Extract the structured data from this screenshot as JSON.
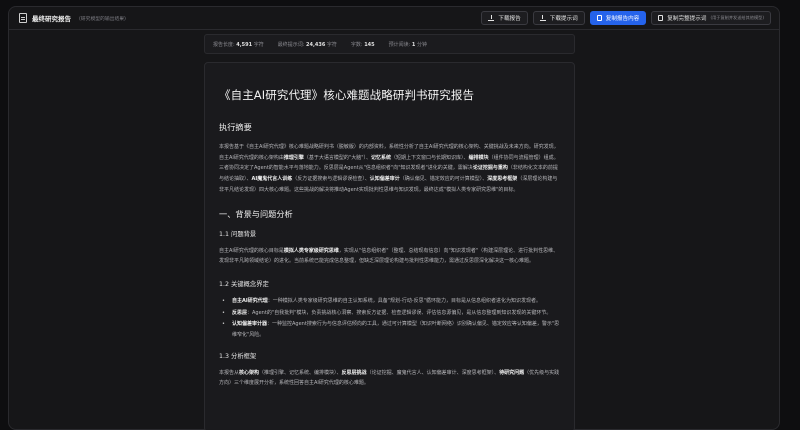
{
  "header": {
    "title": "最终研究报告",
    "subtitle": "(研究模型的输出结果)",
    "buttons": {
      "download_report": "下载报告",
      "download_prompt": "下载提示词",
      "copy_report": "复制报告内容",
      "copy_full_prompt": "复制完整提示词",
      "copy_full_prompt_note": "(用于复制并发送给其他模型)"
    }
  },
  "stats": {
    "report_length_label": "报告长度:",
    "report_length_value": "4,591",
    "report_length_unit": "字符",
    "final_prompt_label": "最终提示词:",
    "final_prompt_value": "24,436",
    "final_prompt_unit": "字符",
    "words_label": "字数:",
    "words_value": "145",
    "time_label": "预计阅读:",
    "time_value": "1",
    "time_unit": "分钟"
  },
  "report": {
    "title": "《自主AI研究代理》核心难题战略研判书研究报告",
    "exec_heading": "执行摘要",
    "exec": {
      "t1": "本报告基于《自主AI研究代理》核心难题战略研判书（脱敏版）的内部资料，系统性分析了自主AI研究代理的核心架构、关键挑战及未来方向。研究发现，自主AI研究代理的核心架构由",
      "b1": "推理引擎",
      "t2": "（基于大语言模型的\"大脑\"）、",
      "b2": "记忆系统",
      "t3": "（短期上下文窗口与长期知识库）、",
      "b3": "编排模块",
      "t4": "（组件协同与流程管理）组成。三者协同决定了Agent的智能水平与落地能力。反思层是Agent从\"信息组织者\"向\"知识发现者\"进化的关键，需解决",
      "b4": "论证挖掘与重构",
      "t5": "（非结构化文本的前提与结论抽取）、",
      "b5": "AI魔鬼代言人训练",
      "t6": "（反方证据搜索与逻辑谬误检查）、",
      "b6": "认知偏差审计",
      "t7": "（确认偏见、锚定效应的可计算模型）、",
      "b7": "深度思考框架",
      "t8": "（深层理论构建与非平凡结论发现）四大核心难题。这些挑战的解决将推动Agent实现批判性思维与知识发现，最终达成\"模拟人类专家研究思维\"的目标。"
    },
    "sec1_heading": "一、背景与问题分析",
    "s11_heading": "1.1 问题背景",
    "s11": {
      "t1": "自主AI研究代理的核心目标是",
      "b1": "模拟人类专家级研究思维",
      "t2": "，实现从\"信息组织者\"（整理、总结现有信息）向\"知识发现者\"（构建深层理论、进行批判性思维、发现非平凡跨领域结论）的进化。当前系统已能完成信息整理，但缺乏深层理论构建与批判性思维能力，需通过反思层深化解决这一核心难题。"
    },
    "s12_heading": "1.2 关键概念界定",
    "s12_items": [
      {
        "b": "自主AI研究代理",
        "t": "：一种模拟人类专家级研究思维的自主认知系统，具备\"规划-行动-反思\"循环能力，目标是从信息组织者进化为知识发现者。"
      },
      {
        "b": "反思层",
        "t": "：Agent的\"自我批判\"模块，负责挑战核心洞察、搜索反方证据、检查逻辑谬误、评估信息源偏见，是从信息整理到知识发现的关键环节。"
      },
      {
        "b": "认知偏差审计器",
        "t": "：一种监控Agent搜索行为与信息评估倾向的工具，通过可计算模型（知识叶断网络）识别确认偏见、锚定效应等认知偏差，警示\"思维窄化\"风险。"
      }
    ],
    "s13_heading": "1.3 分析框架",
    "s13": {
      "t1": "本报告从",
      "b1": "核心架构",
      "t2": "（推理引擎、记忆系统、编排模块）、",
      "b2": "反思层挑战",
      "t3": "（论证挖掘、魔鬼代言人、认知偏差审计、深度思考框架）、",
      "b3": "待研究问题",
      "t4": "（优先级与实践方向）三个维度展开分析，系统性回答自主AI研究代理的核心难题。"
    }
  }
}
